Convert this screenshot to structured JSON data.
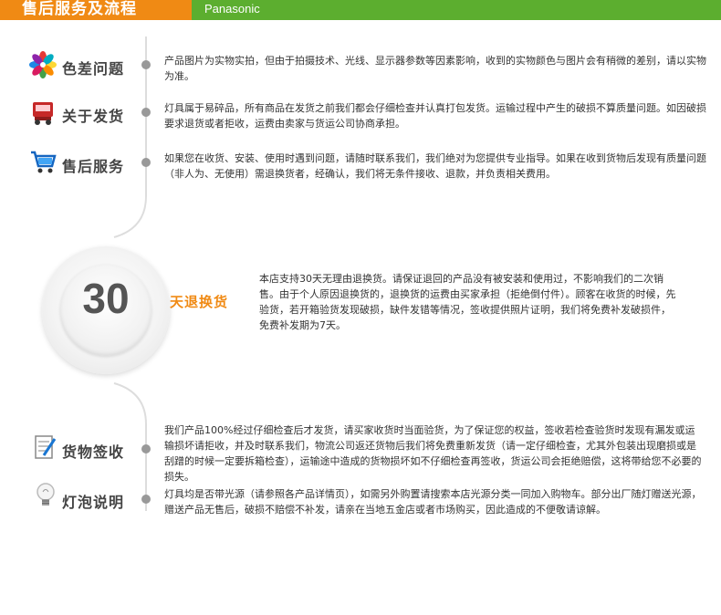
{
  "header": {
    "title": "售后服务及流程",
    "brand": "Panasonic"
  },
  "colors": {
    "header_green": "#5cae2f",
    "header_orange": "#f08a14",
    "accent_orange": "#f08a14"
  },
  "sections": [
    {
      "label": "色差问题",
      "icon": "color-petals-icon",
      "text": "产品图片为实物实拍，但由于拍摄技术、光线、显示器参数等因素影响，收到的实物颜色与图片会有稍微的差别，请以实物为准。"
    },
    {
      "label": "关于发货",
      "icon": "delivery-truck-icon",
      "text": "灯具属于易碎品，所有商品在发货之前我们都会仔细检查并认真打包发货。运输过程中产生的破损不算质量问题。如因破损要求退货或者拒收，运费由卖家与货运公司协商承担。"
    },
    {
      "label": "售后服务",
      "icon": "shopping-cart-icon",
      "text": "如果您在收货、安装、使用时遇到问题，请随时联系我们，我们绝对为您提供专业指导。如果在收到货物后发现有质量问题（非人为、无使用）需退换货者，经确认，我们将无条件接收、退款，并负责相关费用。"
    },
    {
      "label": "货物签收",
      "icon": "sign-document-icon",
      "text": "我们产品100%经过仔细检查后才发货，请买家收货时当面验货，为了保证您的权益，签收若检查验货时发现有漏发或运输损坏请拒收，并及时联系我们，物流公司返还货物后我们将免费重新发货（请一定仔细检查，尤其外包装出现磨损或是刮蹭的时候一定要拆箱检查），运输途中造成的货物损坏如不仔细检查再签收，货运公司会拒绝赔偿，这将带给您不必要的损失。"
    },
    {
      "label": "灯泡说明",
      "icon": "light-bulb-icon",
      "text": "灯具均是否带光源（请参照各产品详情页），如需另外购置请搜索本店光源分类一同加入购物车。部分出厂随灯赠送光源，赠送产品无售后，破损不赔偿不补发，请亲在当地五金店或者市场购买，因此造成的不便敬请谅解。"
    }
  ],
  "return_policy": {
    "number": "30",
    "label": "天退换货",
    "text": "本店支持30天无理由退换货。请保证退回的产品没有被安装和使用过，不影响我们的二次销售。由于个人原因退换货的，退换货的运费由买家承担（拒绝倒付件）。顾客在收货的时候，先验货，若开箱验货发现破损，缺件发错等情况，签收提供照片证明，我们将免费补发破损件，免费补发期为7天。"
  }
}
